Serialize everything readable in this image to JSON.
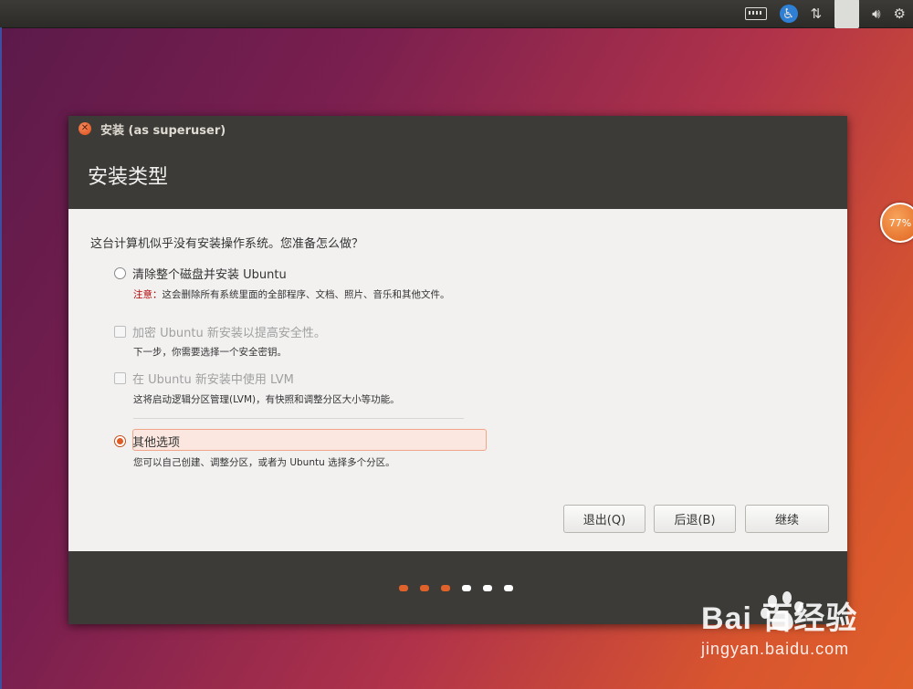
{
  "topbar": {
    "language": "En",
    "icons": [
      "keyboard-icon",
      "accessibility-icon",
      "network-icon",
      "language-indicator",
      "volume-icon",
      "gear-icon"
    ]
  },
  "desktop": {
    "battery_badge": "77%"
  },
  "window": {
    "title": "安装 (as superuser)",
    "heading": "安装类型",
    "question": "这台计算机似乎没有安装操作系统。您准备怎么做？",
    "options": [
      {
        "label": "清除整个磁盘并安装 Ubuntu",
        "desc_prefix": "注意：",
        "desc": "这会删除所有系统里面的全部程序、文档、照片、音乐和其他文件。"
      },
      {
        "label": "加密 Ubuntu 新安装以提高安全性。",
        "desc": "下一步，你需要选择一个安全密钥。"
      },
      {
        "label": "在 Ubuntu 新安装中使用 LVM",
        "desc": "这将启动逻辑分区管理(LVM)，有快照和调整分区大小等功能。"
      },
      {
        "label": "其他选项",
        "desc": "您可以自己创建、调整分区，或者为 Ubuntu 选择多个分区。"
      }
    ],
    "buttons": {
      "quit": "退出(Q)",
      "back": "后退(B)",
      "continue": "继续"
    },
    "progress": {
      "total_steps": 6,
      "completed_steps": 3
    }
  },
  "watermark": {
    "brand": "Bai  百经验",
    "sub": "jingyan.baidu.com"
  },
  "colors": {
    "accent": "#e05a24",
    "chrome": "#3c3b37"
  }
}
